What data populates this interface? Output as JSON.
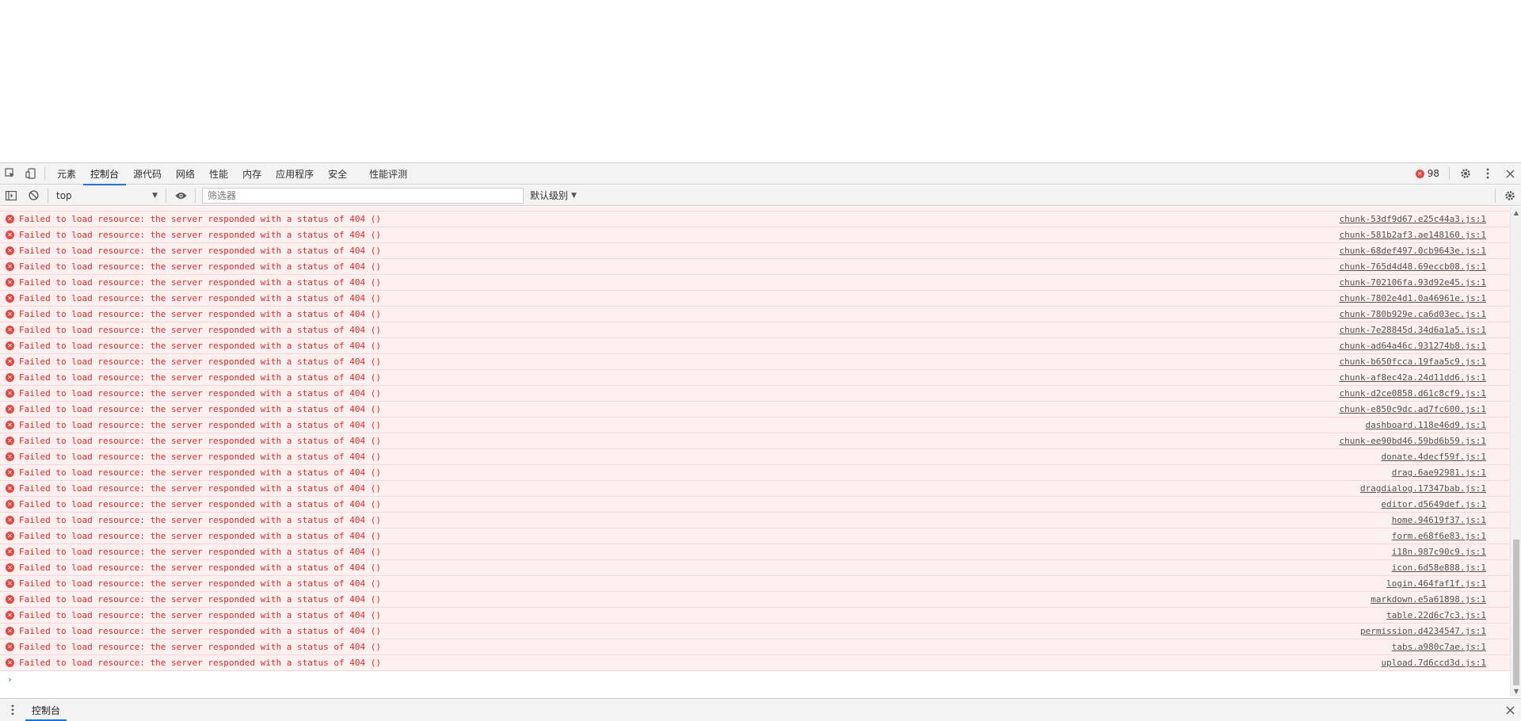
{
  "tabs": [
    {
      "label": "元素",
      "active": false
    },
    {
      "label": "控制台",
      "active": true
    },
    {
      "label": "源代码",
      "active": false
    },
    {
      "label": "网络",
      "active": false
    },
    {
      "label": "性能",
      "active": false
    },
    {
      "label": "内存",
      "active": false
    },
    {
      "label": "应用程序",
      "active": false
    },
    {
      "label": "安全",
      "active": false
    },
    {
      "label": "性能评测",
      "active": false
    }
  ],
  "error_count": "98",
  "toolbar": {
    "context": "top",
    "filter_placeholder": "筛选器",
    "level": "默认级别"
  },
  "partial_source": "chunk-…js:1",
  "messages": [
    {
      "text": "Failed to load resource: the server responded with a status of 404 ()",
      "source": "chunk-53df9d67.e25c44a3.js:1"
    },
    {
      "text": "Failed to load resource: the server responded with a status of 404 ()",
      "source": "chunk-581b2af3.ae148160.js:1"
    },
    {
      "text": "Failed to load resource: the server responded with a status of 404 ()",
      "source": "chunk-68def497.0cb9643e.js:1"
    },
    {
      "text": "Failed to load resource: the server responded with a status of 404 ()",
      "source": "chunk-765d4d48.69eccb08.js:1"
    },
    {
      "text": "Failed to load resource: the server responded with a status of 404 ()",
      "source": "chunk-702106fa.93d92e45.js:1"
    },
    {
      "text": "Failed to load resource: the server responded with a status of 404 ()",
      "source": "chunk-7802e4d1.0a46961e.js:1"
    },
    {
      "text": "Failed to load resource: the server responded with a status of 404 ()",
      "source": "chunk-780b929e.ca6d03ec.js:1"
    },
    {
      "text": "Failed to load resource: the server responded with a status of 404 ()",
      "source": "chunk-7e28845d.34d6a1a5.js:1"
    },
    {
      "text": "Failed to load resource: the server responded with a status of 404 ()",
      "source": "chunk-ad64a46c.931274b8.js:1"
    },
    {
      "text": "Failed to load resource: the server responded with a status of 404 ()",
      "source": "chunk-b650fcca.19faa5c9.js:1"
    },
    {
      "text": "Failed to load resource: the server responded with a status of 404 ()",
      "source": "chunk-af8ec42a.24d11dd6.js:1"
    },
    {
      "text": "Failed to load resource: the server responded with a status of 404 ()",
      "source": "chunk-d2ce0858.d61c8cf9.js:1"
    },
    {
      "text": "Failed to load resource: the server responded with a status of 404 ()",
      "source": "chunk-e850c9dc.ad7fc600.js:1"
    },
    {
      "text": "Failed to load resource: the server responded with a status of 404 ()",
      "source": "dashboard.118e46d9.js:1"
    },
    {
      "text": "Failed to load resource: the server responded with a status of 404 ()",
      "source": "chunk-ee90bd46.59bd6b59.js:1"
    },
    {
      "text": "Failed to load resource: the server responded with a status of 404 ()",
      "source": "donate.4decf59f.js:1"
    },
    {
      "text": "Failed to load resource: the server responded with a status of 404 ()",
      "source": "drag.6ae92981.js:1"
    },
    {
      "text": "Failed to load resource: the server responded with a status of 404 ()",
      "source": "dragdialog.17347bab.js:1"
    },
    {
      "text": "Failed to load resource: the server responded with a status of 404 ()",
      "source": "editor.d5649def.js:1"
    },
    {
      "text": "Failed to load resource: the server responded with a status of 404 ()",
      "source": "home.94619f37.js:1"
    },
    {
      "text": "Failed to load resource: the server responded with a status of 404 ()",
      "source": "form.e68f6e83.js:1"
    },
    {
      "text": "Failed to load resource: the server responded with a status of 404 ()",
      "source": "i18n.987c90c9.js:1"
    },
    {
      "text": "Failed to load resource: the server responded with a status of 404 ()",
      "source": "icon.6d58e888.js:1"
    },
    {
      "text": "Failed to load resource: the server responded with a status of 404 ()",
      "source": "login.464faf1f.js:1"
    },
    {
      "text": "Failed to load resource: the server responded with a status of 404 ()",
      "source": "markdown.e5a61898.js:1"
    },
    {
      "text": "Failed to load resource: the server responded with a status of 404 ()",
      "source": "table.22d6c7c3.js:1"
    },
    {
      "text": "Failed to load resource: the server responded with a status of 404 ()",
      "source": "permission.d4234547.js:1"
    },
    {
      "text": "Failed to load resource: the server responded with a status of 404 ()",
      "source": "tabs.a980c7ae.js:1"
    },
    {
      "text": "Failed to load resource: the server responded with a status of 404 ()",
      "source": "upload.7d6ccd3d.js:1"
    }
  ],
  "drawer": {
    "tab_label": "控制台"
  },
  "colors": {
    "error_text": "#e02a2a",
    "error_bg": "#fff0f0",
    "accent": "#1a73e8",
    "error_icon": "#e8453c"
  }
}
